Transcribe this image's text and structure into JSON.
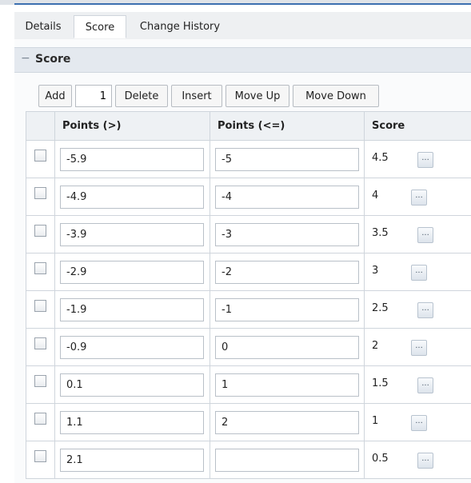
{
  "tabs": [
    {
      "label": "Details"
    },
    {
      "label": "Score"
    },
    {
      "label": "Change History"
    }
  ],
  "active_tab": "Score",
  "section": {
    "title": "Score",
    "collapse_icon": "minus"
  },
  "toolbar": {
    "add_label": "Add",
    "count_value": "1",
    "delete_label": "Delete",
    "insert_label": "Insert",
    "move_up_label": "Move Up",
    "move_down_label": "Move Down"
  },
  "grid": {
    "columns": [
      "Points (>)",
      "Points (<=)",
      "Score"
    ],
    "ellipsis_label": "...",
    "rows": [
      {
        "points_gt": "-5.9",
        "points_le": "-5",
        "score": "4.5"
      },
      {
        "points_gt": "-4.9",
        "points_le": "-4",
        "score": "4"
      },
      {
        "points_gt": "-3.9",
        "points_le": "-3",
        "score": "3.5"
      },
      {
        "points_gt": "-2.9",
        "points_le": "-2",
        "score": "3"
      },
      {
        "points_gt": "-1.9",
        "points_le": "-1",
        "score": "2.5"
      },
      {
        "points_gt": "-0.9",
        "points_le": "0",
        "score": "2"
      },
      {
        "points_gt": "0.1",
        "points_le": "1",
        "score": "1.5"
      },
      {
        "points_gt": "1.1",
        "points_le": "2",
        "score": "1"
      },
      {
        "points_gt": "2.1",
        "points_le": "",
        "score": "0.5"
      }
    ]
  }
}
